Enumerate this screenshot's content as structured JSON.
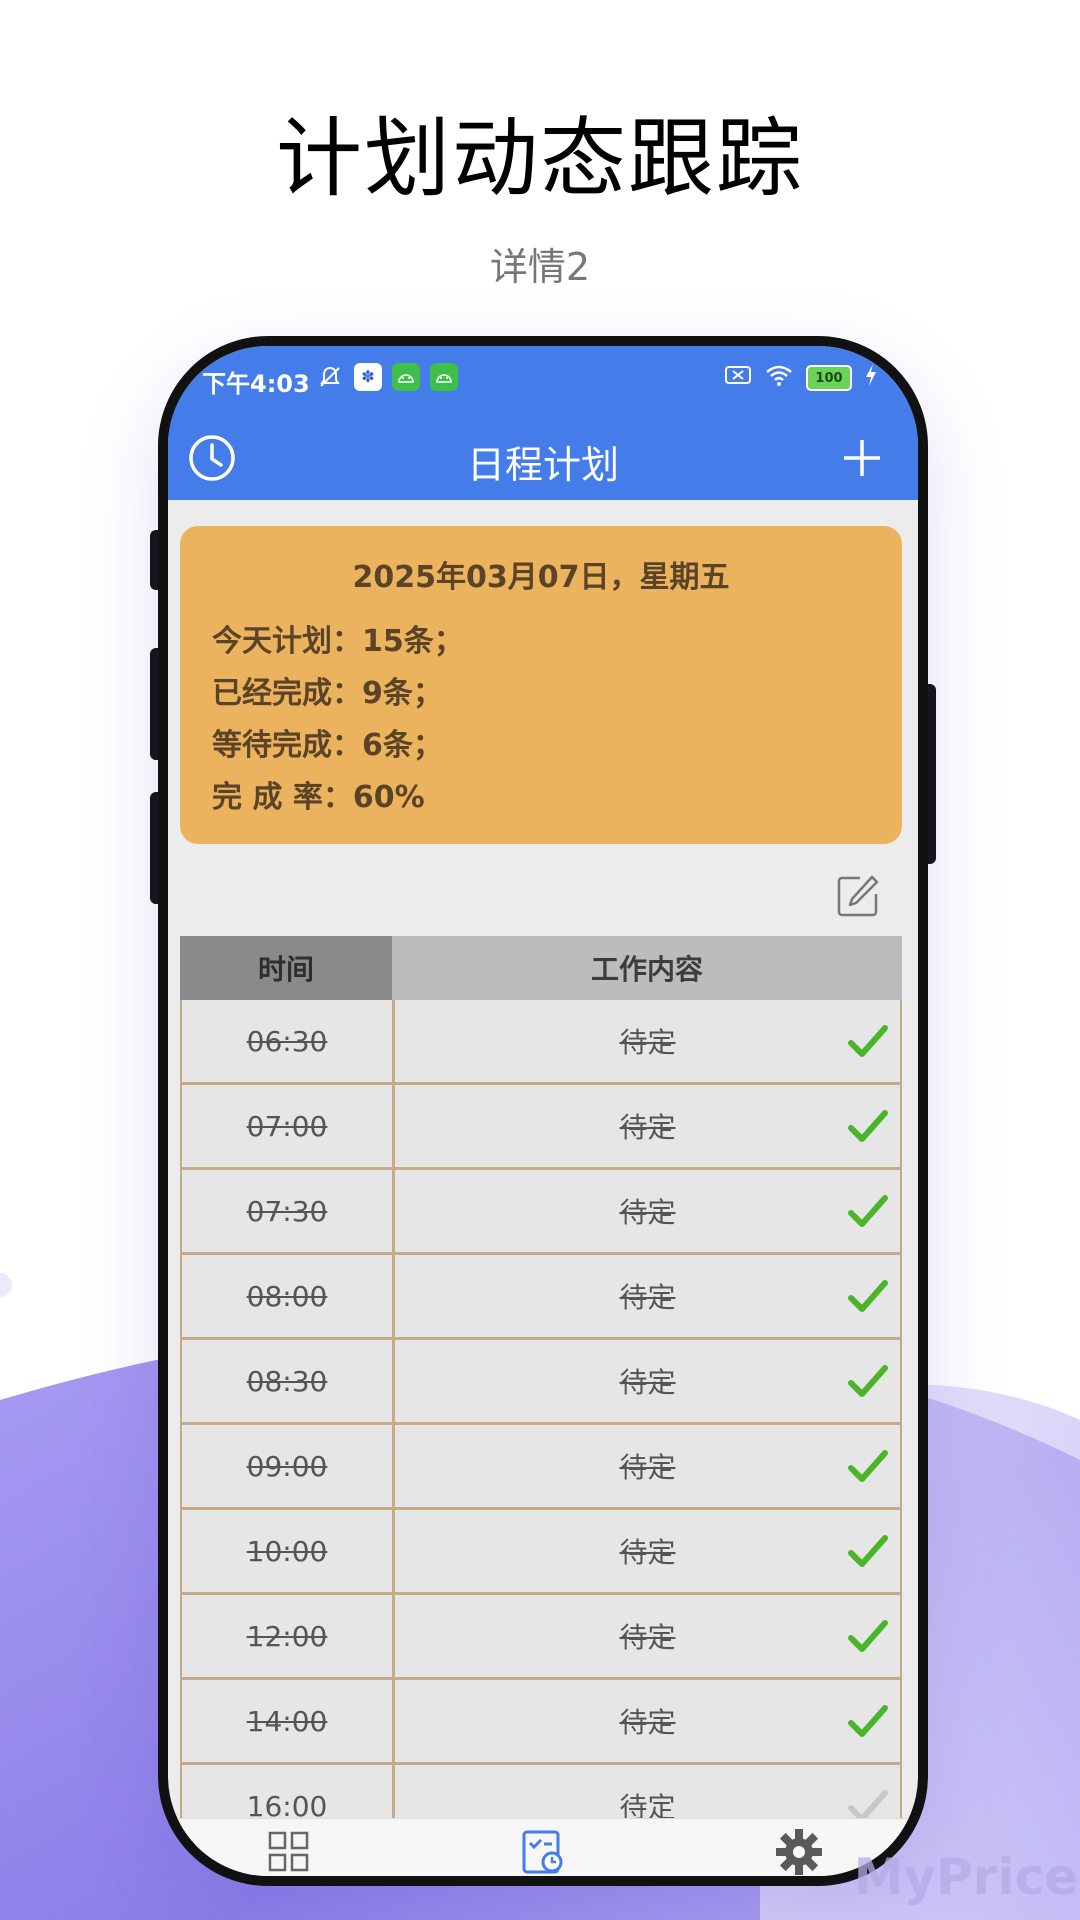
{
  "promo": {
    "title": "计划动态跟踪",
    "subtitle": "详情2"
  },
  "status_bar": {
    "time": "下午4:03",
    "battery": "100",
    "icons": [
      "mute-icon",
      "baidu-icon",
      "android-icon",
      "android-icon",
      "sim-off-icon",
      "wifi-icon",
      "battery-icon",
      "charging-icon"
    ]
  },
  "app_bar": {
    "title": "日程计划"
  },
  "summary": {
    "date": "2025年03月07日，星期五",
    "today_plan": "今天计划：15条；",
    "completed": "已经完成：9条；",
    "waiting": "等待完成：6条；",
    "rate": "完 成 率：60%"
  },
  "table": {
    "headers": {
      "time": "时间",
      "content": "工作内容"
    },
    "rows": [
      {
        "time": "06:30",
        "content": "待定",
        "done": true
      },
      {
        "time": "07:00",
        "content": "待定",
        "done": true
      },
      {
        "time": "07:30",
        "content": "待定",
        "done": true
      },
      {
        "time": "08:00",
        "content": "待定",
        "done": true
      },
      {
        "time": "08:30",
        "content": "待定",
        "done": true
      },
      {
        "time": "09:00",
        "content": "待定",
        "done": true
      },
      {
        "time": "10:00",
        "content": "待定",
        "done": true
      },
      {
        "time": "12:00",
        "content": "待定",
        "done": true
      },
      {
        "time": "14:00",
        "content": "待定",
        "done": true
      },
      {
        "time": "16:00",
        "content": "待定",
        "done": false
      }
    ]
  },
  "colors": {
    "primary": "#447cea",
    "summary_card": "#ecb35e",
    "check_done": "#4ab528",
    "check_pending": "#c8c8c8",
    "row_border": "#c5aa8c"
  },
  "watermark": "MyPrice"
}
